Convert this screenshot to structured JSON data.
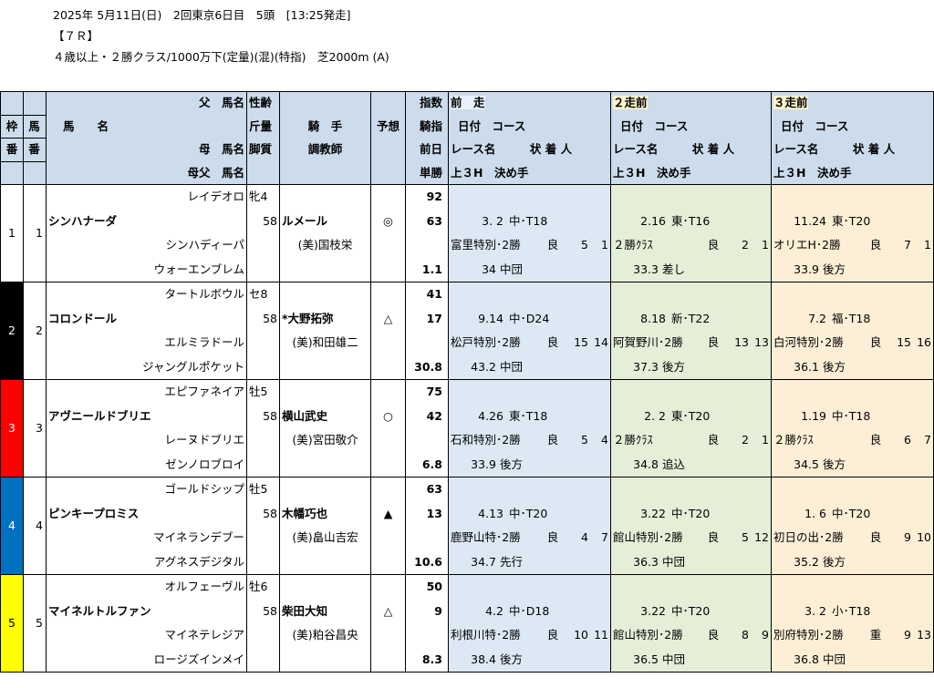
{
  "header": {
    "line1": "2025年 5月11日(日)　2回東京6日目　5頭　[13:25発走]",
    "line2": "【７Ｒ】",
    "line3": "４歳以上・２勝クラス/1000万下(定量)(混)(特指)　芝2000m (A)"
  },
  "columns": {
    "waku": [
      "枠",
      "番"
    ],
    "uma": [
      "馬",
      "番"
    ],
    "name": [
      "父　馬名",
      "馬　　名",
      "母　馬名",
      "母父　馬名"
    ],
    "sex": [
      "性齢",
      "斤量",
      "脚質"
    ],
    "jockey": [
      "騎　手",
      "調教師"
    ],
    "yoso": "予想",
    "idx": [
      "指数",
      "騎指",
      "前日",
      "単勝"
    ],
    "prev1": [
      "前　走",
      "日付　コース",
      "レース名　　　状 着 人",
      "上３H　決め手"
    ],
    "prev2": [
      "２走前",
      "日付　コース",
      "レース名　　　状 着 人",
      "上３H　決め手"
    ],
    "prev3": [
      "３走前",
      "日付　コース",
      "レース名　　　状 着 人",
      "上３H　決め手"
    ]
  },
  "horses": [
    {
      "waku": "1",
      "uma": "1",
      "waku_bg": "#ffffff",
      "waku_fg": "#000000",
      "sire": "レイデオロ",
      "name": "シンハナーダ",
      "dam": "シンハディーパ",
      "damsire": "ウォーエンブレム",
      "sexage": "牝4",
      "weight": "58",
      "style": "",
      "jockey": "ルメール",
      "trainer": "(美)国枝栄",
      "yoso": "◎",
      "idx": "92",
      "jidx": "63",
      "prevday": "",
      "odds": "1.1",
      "p1": {
        "date": "3. 2",
        "course": "中･T18",
        "race": "富里特別･2勝",
        "cond": "良",
        "pos": "5",
        "pop": "1",
        "up": "34",
        "style": "中団"
      },
      "p2": {
        "date": "2.16",
        "course": "東･T16",
        "race": "２勝ｸﾗｽ",
        "cond": "良",
        "pos": "2",
        "pop": "1",
        "up": "33.3",
        "style": "差し"
      },
      "p3": {
        "date": "11.24",
        "course": "東･T20",
        "race": "オリエH･2勝",
        "cond": "良",
        "pos": "7",
        "pop": "1",
        "up": "33.9",
        "style": "後方"
      }
    },
    {
      "waku": "2",
      "uma": "2",
      "waku_bg": "#000000",
      "waku_fg": "#ffffff",
      "sire": "タートルボウル",
      "name": "コロンドール",
      "dam": "エルミラドール",
      "damsire": "ジャングルポケット",
      "sexage": "セ8",
      "weight": "58",
      "style": "",
      "jockey": "*大野拓弥",
      "trainer": "(美)和田雄二",
      "yoso": "△",
      "idx": "41",
      "jidx": "17",
      "prevday": "",
      "odds": "30.8",
      "p1": {
        "date": "9.14",
        "course": "中･D24",
        "race": "松戸特別･2勝",
        "cond": "良",
        "pos": "15",
        "pop": "14",
        "up": "43.2",
        "style": "中団"
      },
      "p2": {
        "date": "8.18",
        "course": "新･T22",
        "race": "阿賀野川･2勝",
        "cond": "良",
        "pos": "13",
        "pop": "13",
        "up": "37.3",
        "style": "後方"
      },
      "p3": {
        "date": "7.2",
        "course": "福･T18",
        "race": "白河特別･2勝",
        "cond": "良",
        "pos": "15",
        "pop": "16",
        "up": "36.1",
        "style": "後方"
      }
    },
    {
      "waku": "3",
      "uma": "3",
      "waku_bg": "#ff0000",
      "waku_fg": "#ffffff",
      "sire": "エピファネイア",
      "name": "アヴニールドブリエ",
      "dam": "レーヌドブリエ",
      "damsire": "ゼンノロブロイ",
      "sexage": "牡5",
      "weight": "58",
      "style": "",
      "jockey": "横山武史",
      "trainer": "(美)宮田敬介",
      "yoso": "○",
      "idx": "75",
      "jidx": "42",
      "prevday": "",
      "odds": "6.8",
      "p1": {
        "date": "4.26",
        "course": "東･T18",
        "race": "石和特別･2勝",
        "cond": "良",
        "pos": "5",
        "pop": "4",
        "up": "33.9",
        "style": "後方"
      },
      "p2": {
        "date": "2. 2",
        "course": "東･T20",
        "race": "２勝ｸﾗｽ",
        "cond": "良",
        "pos": "2",
        "pop": "1",
        "up": "34.8",
        "style": "追込"
      },
      "p3": {
        "date": "1.19",
        "course": "中･T18",
        "race": "２勝ｸﾗｽ",
        "cond": "良",
        "pos": "6",
        "pop": "7",
        "up": "34.5",
        "style": "後方"
      }
    },
    {
      "waku": "4",
      "uma": "4",
      "waku_bg": "#0070c0",
      "waku_fg": "#ffffff",
      "sire": "ゴールドシップ",
      "name": "ピンキープロミス",
      "dam": "マイネランデブー",
      "damsire": "アグネスデジタル",
      "sexage": "牡5",
      "weight": "58",
      "style": "",
      "jockey": "木幡巧也",
      "trainer": "(美)畠山吉宏",
      "yoso": "▲",
      "idx": "63",
      "jidx": "13",
      "prevday": "",
      "odds": "10.6",
      "p1": {
        "date": "4.13",
        "course": "中･T20",
        "race": "鹿野山特･2勝",
        "cond": "良",
        "pos": "4",
        "pop": "7",
        "up": "34.7",
        "style": "先行"
      },
      "p2": {
        "date": "3.22",
        "course": "中･T20",
        "race": "館山特別･2勝",
        "cond": "良",
        "pos": "5",
        "pop": "12",
        "up": "36.3",
        "style": "中団"
      },
      "p3": {
        "date": "1. 6",
        "course": "中･T20",
        "race": "初日の出･2勝",
        "cond": "良",
        "pos": "9",
        "pop": "10",
        "up": "35.2",
        "style": "後方"
      }
    },
    {
      "waku": "5",
      "uma": "5",
      "waku_bg": "#ffff00",
      "waku_fg": "#000000",
      "sire": "オルフェーヴル",
      "name": "マイネルトルファン",
      "dam": "マイネテレジア",
      "damsire": "ロージズインメイ",
      "sexage": "牡6",
      "weight": "58",
      "style": "",
      "jockey": "柴田大知",
      "trainer": "(美)粕谷昌央",
      "yoso": "△",
      "idx": "50",
      "jidx": "9",
      "prevday": "",
      "odds": "8.3",
      "p1": {
        "date": "4.2",
        "course": "中･D18",
        "race": "利根川特･2勝",
        "cond": "良",
        "pos": "10",
        "pop": "11",
        "up": "38.4",
        "style": "後方"
      },
      "p2": {
        "date": "3.22",
        "course": "中･T20",
        "race": "館山特別･2勝",
        "cond": "良",
        "pos": "8",
        "pop": "9",
        "up": "36.5",
        "style": "中団"
      },
      "p3": {
        "date": "3. 2",
        "course": "小･T18",
        "race": "別府特別･2勝",
        "cond": "重",
        "pos": "9",
        "pop": "13",
        "up": "36.8",
        "style": "中団"
      }
    }
  ]
}
